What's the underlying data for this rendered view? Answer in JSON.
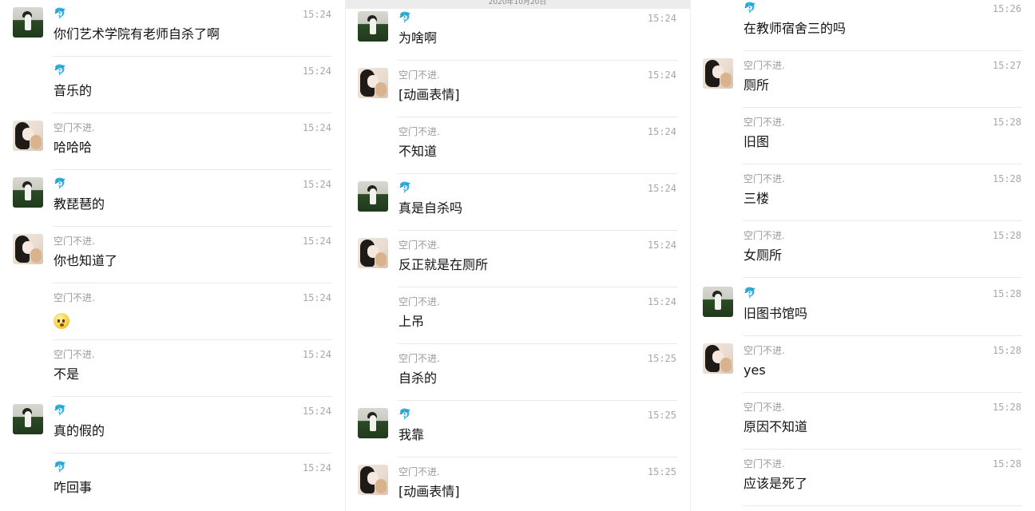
{
  "columns": [
    {
      "messages": [
        {
          "sender": "🐬",
          "time": "15:24",
          "text": "你们艺术学院有老师自杀了啊"
        },
        {
          "sender": "🐬",
          "time": "15:24",
          "text": "音乐的"
        },
        {
          "sender": "空门不进.",
          "time": "15:24",
          "text": "哈哈哈"
        },
        {
          "sender": "🐬",
          "time": "15:24",
          "text": "教琵琶的"
        },
        {
          "sender": "空门不进.",
          "time": "15:24",
          "text": "你也知道了"
        },
        {
          "sender": "空门不进.",
          "time": "15:24",
          "text": ""
        },
        {
          "sender": "空门不进.",
          "time": "15:24",
          "text": "不是"
        },
        {
          "sender": "🐬",
          "time": "15:24",
          "text": "真的假的"
        },
        {
          "sender": "🐬",
          "time": "15:24",
          "text": "咋回事"
        }
      ]
    },
    {
      "top_date": "2020年10月20日",
      "messages": [
        {
          "sender": "🐬",
          "time": "15:24",
          "text": "为啥啊"
        },
        {
          "sender": "空门不进.",
          "time": "15:24",
          "text": "[动画表情]"
        },
        {
          "sender": "空门不进.",
          "time": "15:24",
          "text": "不知道"
        },
        {
          "sender": "🐬",
          "time": "15:24",
          "text": "真是自杀吗"
        },
        {
          "sender": "空门不进.",
          "time": "15:24",
          "text": "反正就是在厕所"
        },
        {
          "sender": "空门不进.",
          "time": "15:24",
          "text": "上吊"
        },
        {
          "sender": "空门不进.",
          "time": "15:25",
          "text": "自杀的"
        },
        {
          "sender": "🐬",
          "time": "15:25",
          "text": "我靠"
        },
        {
          "sender": "空门不进.",
          "time": "15:25",
          "text": "[动画表情]"
        }
      ]
    },
    {
      "messages": [
        {
          "sender": "🐬",
          "time": "15:26",
          "text": "在教师宿舍三的吗"
        },
        {
          "sender": "空门不进.",
          "time": "15:27",
          "text": "厕所"
        },
        {
          "sender": "空门不进.",
          "time": "15:28",
          "text": "旧图"
        },
        {
          "sender": "空门不进.",
          "time": "15:28",
          "text": "三楼"
        },
        {
          "sender": "空门不进.",
          "time": "15:28",
          "text": "女厕所"
        },
        {
          "sender": "🐬",
          "time": "15:28",
          "text": "旧图书馆吗"
        },
        {
          "sender": "空门不进.",
          "time": "15:28",
          "text": "yes"
        },
        {
          "sender": "空门不进.",
          "time": "15:28",
          "text": "原因不知道"
        },
        {
          "sender": "空门不进.",
          "time": "15:28",
          "text": "应该是死了"
        }
      ]
    }
  ],
  "icons": {
    "emoji_message": "speechless-face-emoji-icon",
    "avatar_a": "bird-avatar",
    "avatar_b": "girl-avatar"
  }
}
